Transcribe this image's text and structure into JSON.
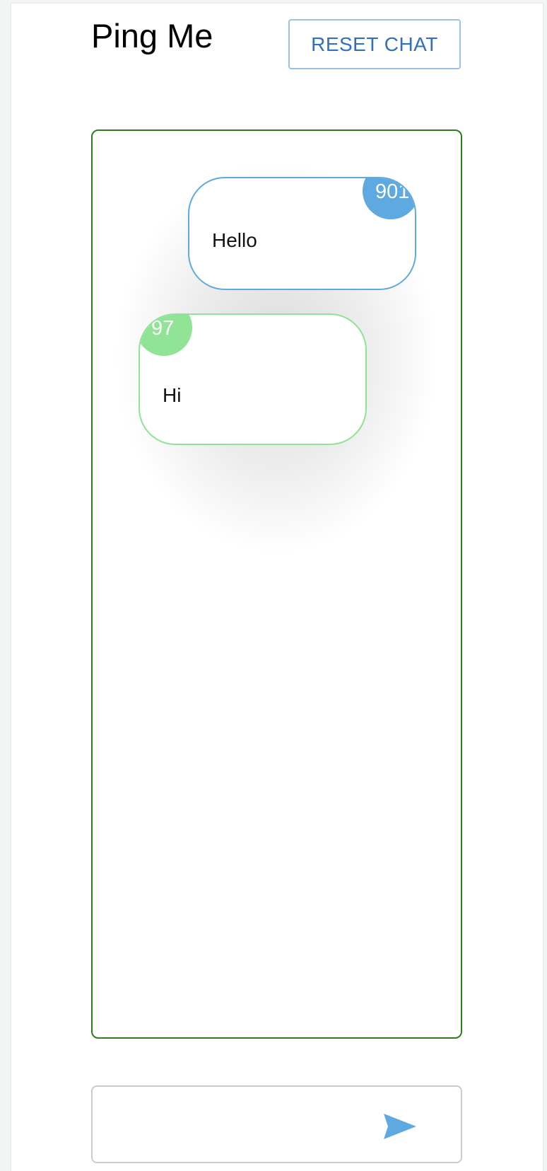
{
  "app": {
    "title": "Ping Me"
  },
  "header": {
    "reset_label": "RESET CHAT"
  },
  "messages": [
    {
      "badge": "901",
      "text": "Hello",
      "color": "#5ea9df",
      "side": "right"
    },
    {
      "badge": "97",
      "text": "Hi",
      "color": "#91e395",
      "side": "left"
    }
  ],
  "composer": {
    "value": "",
    "send_icon": "send-icon"
  },
  "colors": {
    "accent_blue": "#2f70c0",
    "chat_border": "#2f7d1a"
  }
}
